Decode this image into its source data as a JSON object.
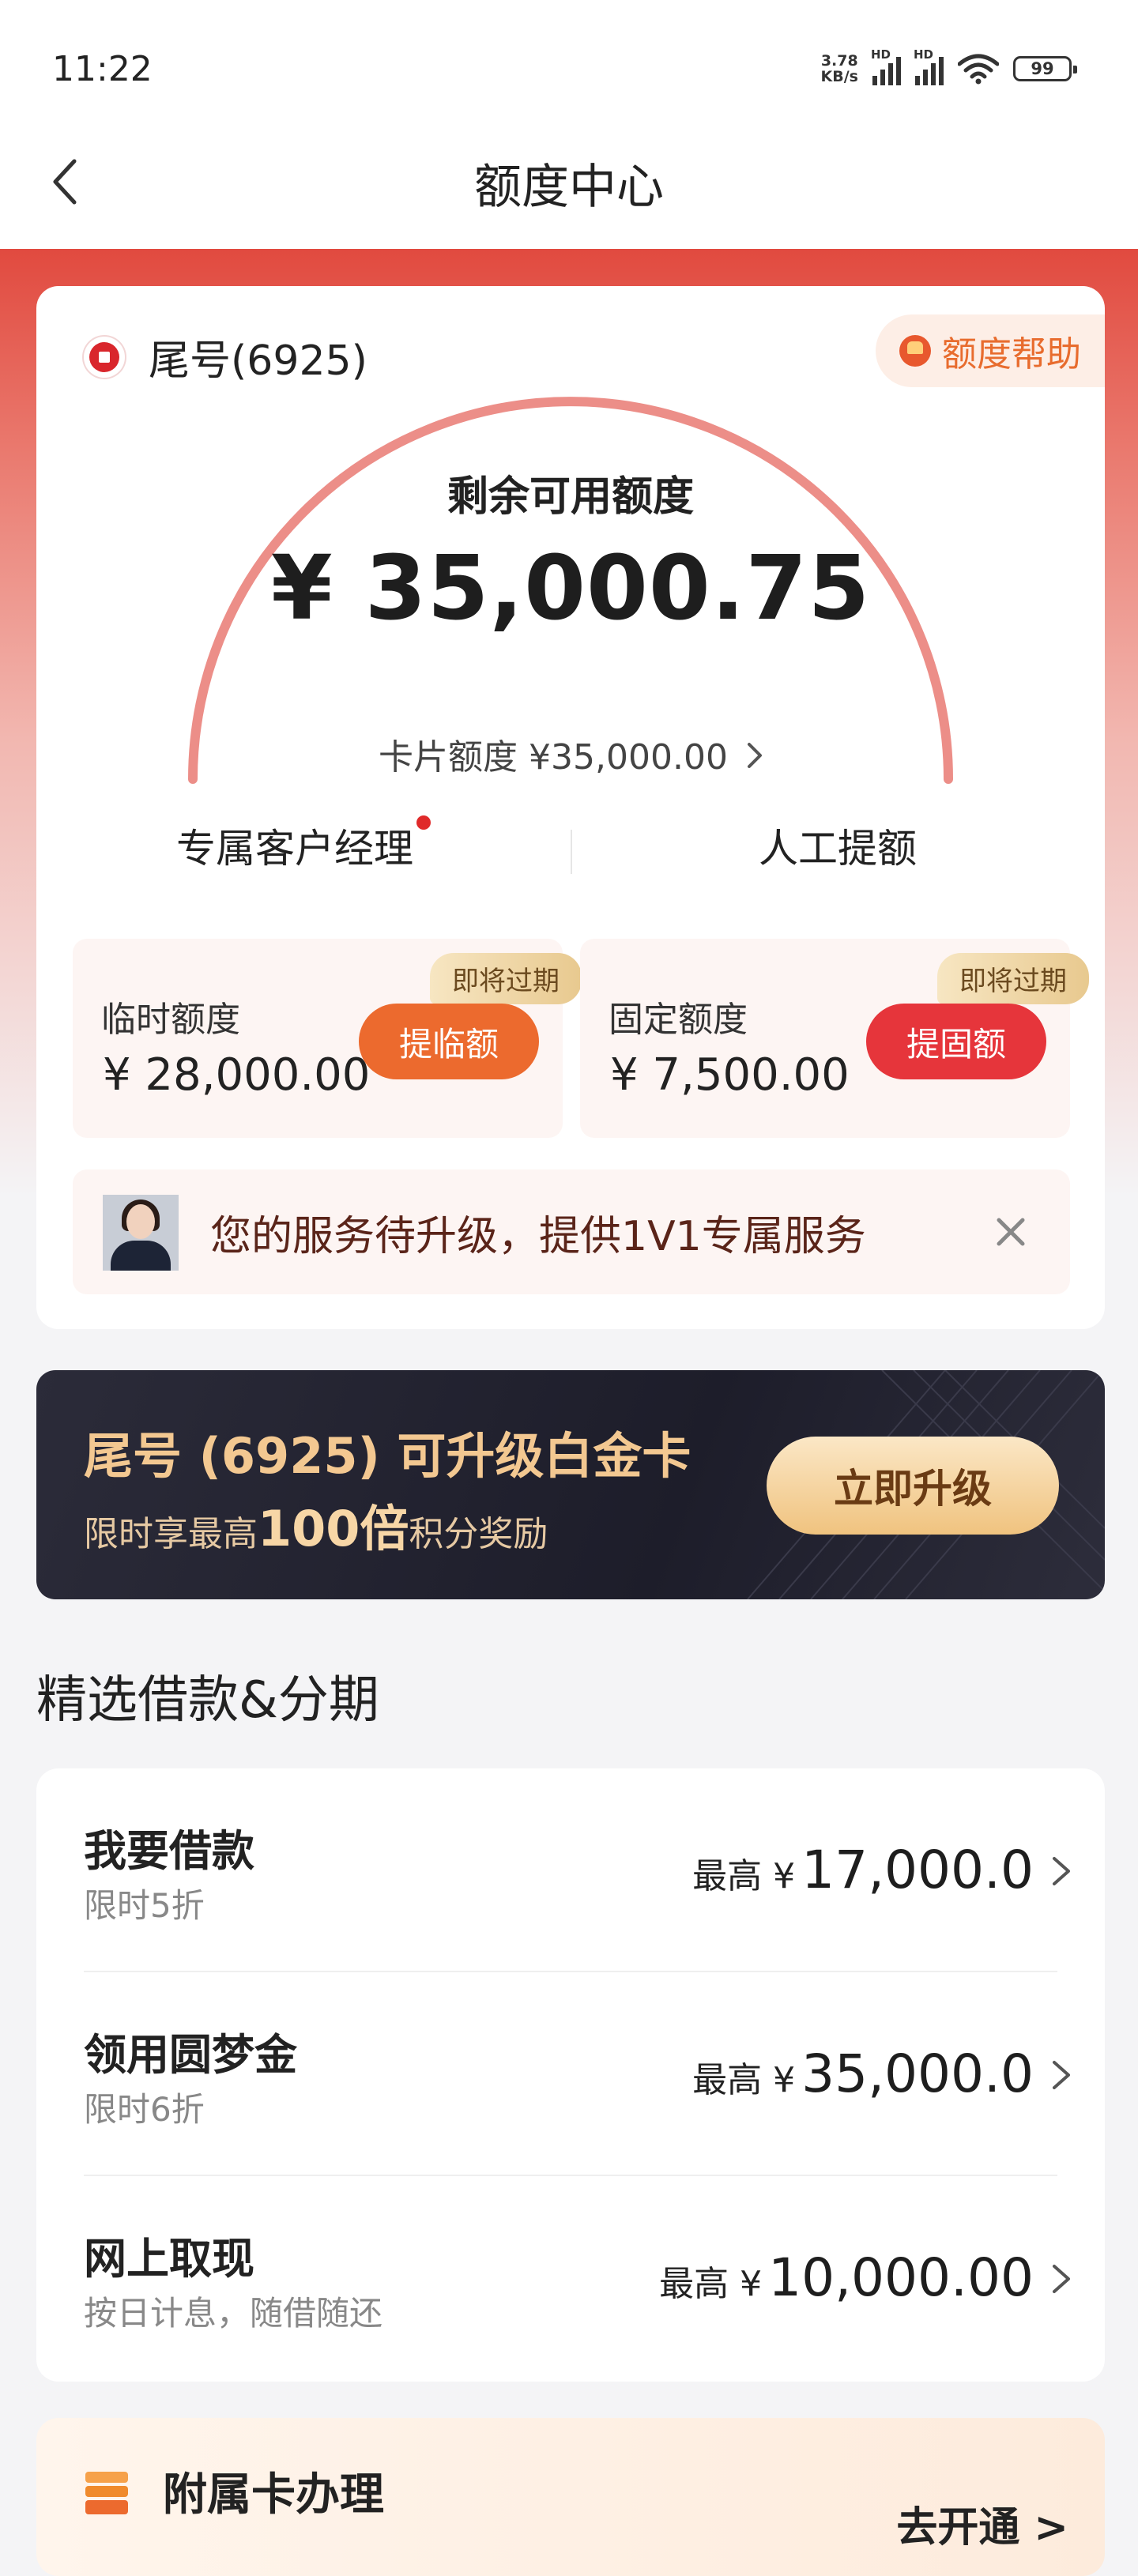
{
  "status_bar": {
    "time": "11:22",
    "net_speed_value": "3.78",
    "net_speed_unit": "KB/s",
    "sim1_label": "HD",
    "sim2_label": "HD",
    "battery": "99"
  },
  "nav": {
    "title": "额度中心",
    "back_icon": "chevron-left-icon"
  },
  "quota_card": {
    "card_tail": "尾号(6925)",
    "help_label": "额度帮助",
    "remaining_label": "剩余可用额度",
    "remaining_amount": "¥ 35,000.75",
    "card_limit_label": "卡片额度 ¥35,000.00",
    "manager_label": "专属客户经理",
    "manual_raise_label": "人工提额",
    "temp": {
      "label": "临时额度",
      "amount": "¥ 28,000.00",
      "tag": "即将过期",
      "button": "提临额"
    },
    "fixed": {
      "label": "固定额度",
      "amount": "¥ 7,500.00",
      "tag": "即将过期",
      "button": "提固额"
    },
    "service_text": "您的服务待升级，提供1V1专属服务"
  },
  "banner": {
    "title": "尾号 (6925) 可升级白金卡",
    "sub_prefix": "限时享最高",
    "sub_highlight": "100倍",
    "sub_suffix": "积分奖励",
    "button": "立即升级"
  },
  "section_title": "精选借款&分期",
  "loans": [
    {
      "name": "我要借款",
      "desc": "限时5折",
      "max_prefix": "最高 ¥",
      "max_amount": "17,000.0"
    },
    {
      "name": "领用圆梦金",
      "desc": "限时6折",
      "max_prefix": "最高 ¥",
      "max_amount": "35,000.0"
    },
    {
      "name": "网上取现",
      "desc": "按日计息，随借随还",
      "max_prefix": "最高 ¥",
      "max_amount": "10,000.00"
    }
  ],
  "attach_card": {
    "title": "附属卡办理",
    "action": "去开通 >"
  },
  "colors": {
    "brand_red": "#e14a3f",
    "orange_button": "#ec6a2e",
    "red_button": "#e6353b",
    "gold": "#f0c37f"
  }
}
